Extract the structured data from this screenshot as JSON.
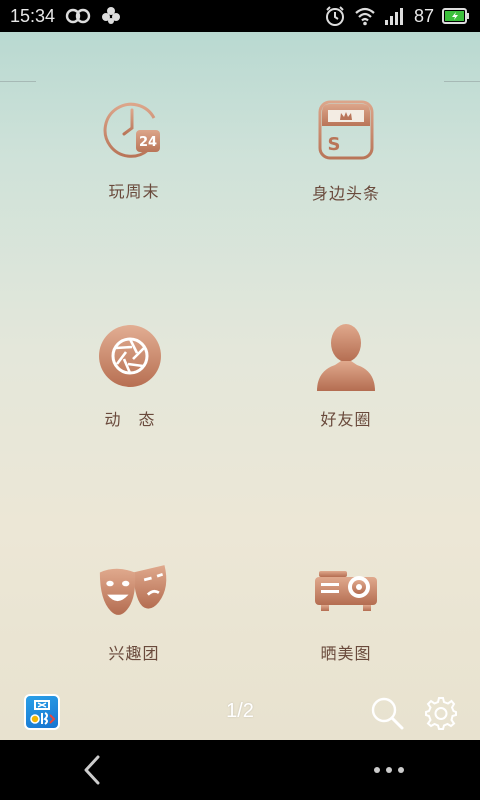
{
  "status_bar": {
    "time": "15:34",
    "battery": "87",
    "icons": [
      "infinity-icon",
      "flower-icon",
      "alarm-icon",
      "wifi-icon",
      "signal-icon",
      "battery-icon"
    ]
  },
  "tiles": [
    {
      "label": "玩周末",
      "icon": "clock-24-icon"
    },
    {
      "label": "身边头条",
      "icon": "news-s-icon"
    },
    {
      "label": "动　态",
      "icon": "aperture-icon"
    },
    {
      "label": "好友圈",
      "icon": "person-icon"
    },
    {
      "label": "兴趣团",
      "icon": "masks-icon"
    },
    {
      "label": "晒美图",
      "icon": "projector-icon"
    }
  ],
  "bottom": {
    "page_indicator": "1/2",
    "app_badge_icon": "app-logo-icon"
  },
  "colors": {
    "icon_copper": "#c9886a",
    "label_brown": "#6a4a3c"
  }
}
